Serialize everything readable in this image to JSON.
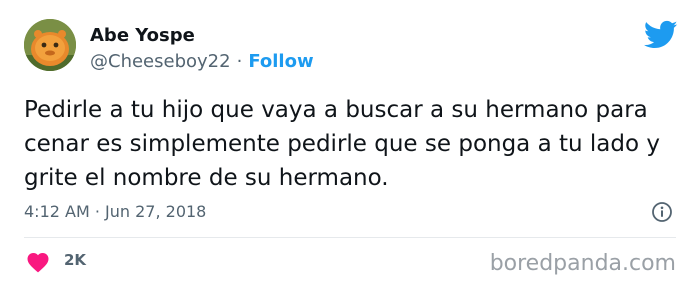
{
  "author": {
    "display_name": "Abe Yospe",
    "handle": "@Cheeseboy22",
    "separator": "·",
    "follow_label": "Follow"
  },
  "tweet": {
    "lines": [
      "Pedirle a tu hijo que vaya a buscar a su hermano para",
      "cenar es simplemente pedirle que se ponga a tu lado y",
      "grite el nombre de su hermano."
    ],
    "timestamp": "4:12 AM · Jun 27, 2018"
  },
  "engagement": {
    "likes": "2K"
  },
  "watermark": "boredpanda.com",
  "colors": {
    "accent": "#1d9bf0",
    "heart": "#f91880",
    "muted": "#536471"
  },
  "icons": {
    "brand": "twitter-bird-icon",
    "info": "info-icon",
    "like": "heart-icon"
  }
}
